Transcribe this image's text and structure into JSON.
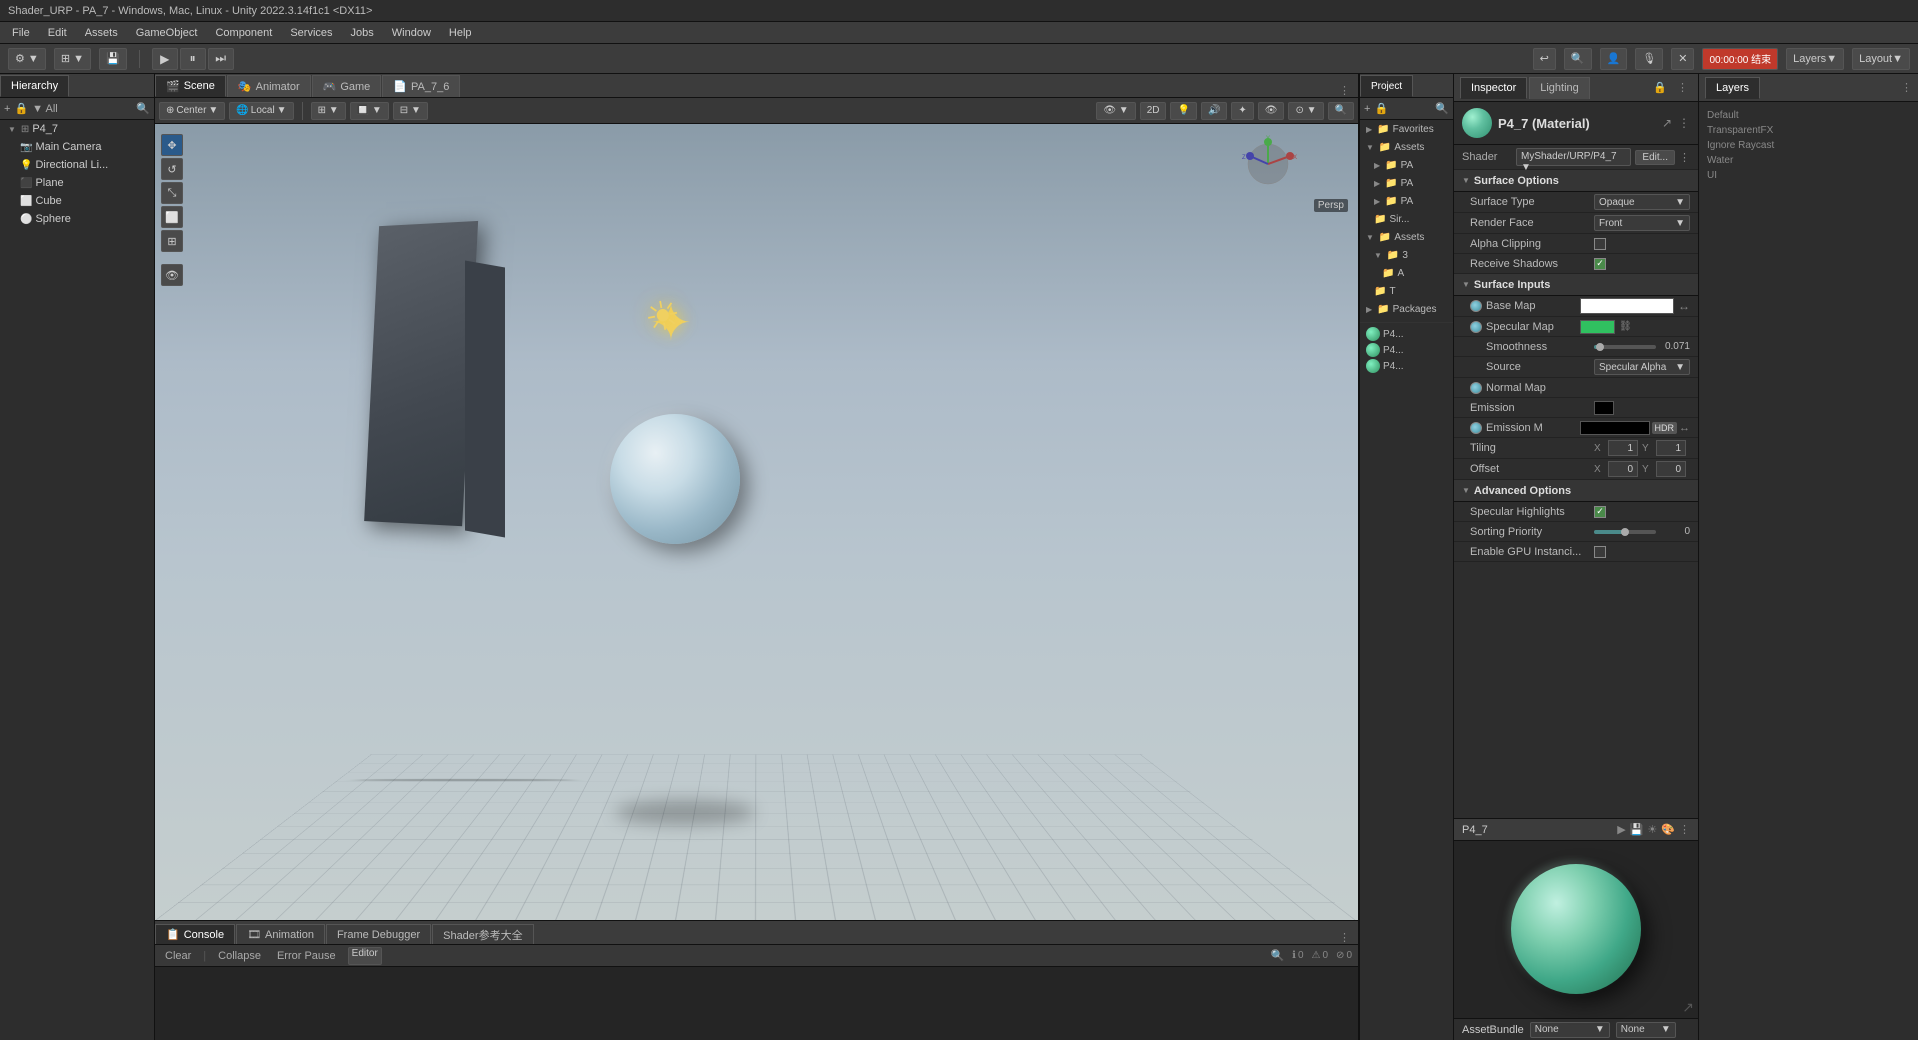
{
  "titlebar": {
    "title": "Shader_URP - PA_7 - Windows, Mac, Linux - Unity 2022.3.14f1c1 <DX11>"
  },
  "menubar": {
    "items": [
      "File",
      "Edit",
      "Assets",
      "GameObject",
      "Component",
      "Services",
      "Jobs",
      "Window",
      "Help"
    ]
  },
  "toolbar": {
    "play": "▶",
    "pause": "⏸",
    "step": "⏭",
    "timer": "00:00:00 结束",
    "layers_label": "Layers",
    "layout_label": "Layout"
  },
  "hierarchy": {
    "title": "Hierarchy",
    "items": [
      {
        "label": "P4_7",
        "indent": 0,
        "arrow": "▼"
      },
      {
        "label": "Main Camera",
        "indent": 1,
        "arrow": ""
      },
      {
        "label": "Directional Li...",
        "indent": 1,
        "arrow": ""
      },
      {
        "label": "Plane",
        "indent": 1,
        "arrow": ""
      },
      {
        "label": "Cube",
        "indent": 1,
        "arrow": ""
      },
      {
        "label": "Sphere",
        "indent": 1,
        "arrow": ""
      }
    ]
  },
  "scene_tabs": {
    "tabs": [
      {
        "label": "Scene",
        "icon": "🎬",
        "active": true
      },
      {
        "label": "Animator",
        "icon": "🎭",
        "active": false
      },
      {
        "label": "Game",
        "icon": "🎮",
        "active": false
      },
      {
        "label": "PA_7_6",
        "icon": "📄",
        "active": false
      }
    ]
  },
  "scene_toolbar": {
    "center": "Center",
    "local": "Local",
    "mode_2d": "2D",
    "persp": "Persp"
  },
  "bottom_tabs": {
    "tabs": [
      {
        "label": "Console",
        "icon": "📋",
        "active": true
      },
      {
        "label": "Animation",
        "icon": "🎞",
        "active": false
      },
      {
        "label": "Frame Debugger",
        "active": false
      },
      {
        "label": "Shader参考大全",
        "active": false
      }
    ],
    "clear": "Clear",
    "collapse": "Collapse",
    "error_pause": "Error Pause",
    "editor": "Editor",
    "counters": {
      "info": "0",
      "warning": "0",
      "error": "0"
    }
  },
  "inspector": {
    "title": "Inspector",
    "lighting_tab": "Lighting",
    "material_name": "P4_7 (Material)",
    "shader_label": "Shader",
    "shader_value": "MyShader/URP/P4_7",
    "edit_btn": "Edit...",
    "sections": {
      "surface_options": {
        "title": "Surface Options",
        "fields": [
          {
            "label": "Surface Type",
            "type": "dropdown",
            "value": "Opaque"
          },
          {
            "label": "Render Face",
            "type": "dropdown",
            "value": "Front"
          },
          {
            "label": "Alpha Clipping",
            "type": "checkbox",
            "checked": false
          },
          {
            "label": "Receive Shadows",
            "type": "checkbox",
            "checked": true
          }
        ]
      },
      "surface_inputs": {
        "title": "Surface Inputs",
        "fields": [
          {
            "label": "Base Map",
            "type": "texture_color"
          },
          {
            "label": "Specular Map",
            "type": "specular"
          },
          {
            "label": "Smoothness",
            "type": "slider",
            "value": 0.071,
            "percent": 10
          },
          {
            "label": "Source",
            "type": "dropdown",
            "value": "Specular Alpha"
          },
          {
            "label": "Normal Map",
            "type": "normal"
          },
          {
            "label": "Emission",
            "type": "color"
          },
          {
            "label": "Emission M",
            "type": "hdr"
          }
        ]
      },
      "tiling_offset": {
        "tiling_label": "Tiling",
        "offset_label": "Offset",
        "tiling_x": "1",
        "tiling_y": "1",
        "offset_x": "0",
        "offset_y": "0"
      },
      "advanced_options": {
        "title": "Advanced Options",
        "fields": [
          {
            "label": "Specular Highlights",
            "type": "checkbox",
            "checked": true
          },
          {
            "label": "Sorting Priority",
            "type": "slider",
            "value": 0,
            "percent": 50
          },
          {
            "label": "Enable GPU Instanci...",
            "type": "checkbox",
            "checked": false
          }
        ]
      }
    }
  },
  "preview": {
    "name": "P4_7",
    "asset_bundle_label": "AssetBundle",
    "asset_bundle_value": "None",
    "asset_bundle_variant": "None"
  },
  "project_panel": {
    "title": "Project",
    "items": [
      {
        "label": "Favorites",
        "folder": true,
        "indent": 0
      },
      {
        "label": "Assets",
        "folder": true,
        "indent": 0
      },
      {
        "label": "PA",
        "folder": true,
        "indent": 1
      },
      {
        "label": "PA",
        "folder": true,
        "indent": 1
      },
      {
        "label": "PA",
        "folder": true,
        "indent": 1
      },
      {
        "label": "Sir...",
        "folder": true,
        "indent": 1
      },
      {
        "label": "Assets",
        "folder": true,
        "indent": 0
      },
      {
        "label": "3",
        "folder": true,
        "indent": 1
      },
      {
        "label": "A",
        "folder": true,
        "indent": 2
      },
      {
        "label": "T",
        "folder": true,
        "indent": 1
      },
      {
        "label": "Packages",
        "folder": true,
        "indent": 0
      }
    ],
    "asset_items": [
      {
        "label": "P4..."
      },
      {
        "label": "P4..."
      },
      {
        "label": "P4..."
      }
    ]
  }
}
